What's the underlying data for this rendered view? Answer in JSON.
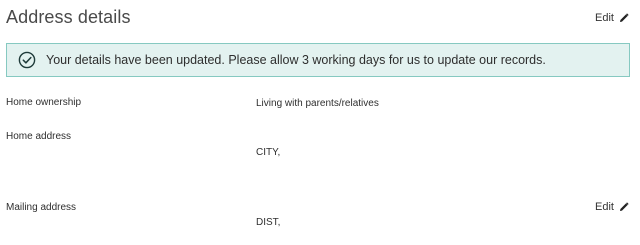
{
  "section": {
    "title": "Address details",
    "edit_label": "Edit"
  },
  "banner": {
    "icon": "check-circle-icon",
    "message": "Your details have been updated. Please allow 3 working days for us to update our records.",
    "accent_color": "#86c9c1",
    "background_color": "#e3f2f0"
  },
  "fields": {
    "home_ownership": {
      "label": "Home ownership",
      "value": "Living with parents/relatives"
    },
    "home_address": {
      "label": "Home address",
      "value": "CITY,"
    },
    "mailing_address": {
      "label": "Mailing address",
      "value": "DIST,",
      "edit_label": "Edit"
    }
  },
  "icons": {
    "edit": "pencil-icon"
  }
}
